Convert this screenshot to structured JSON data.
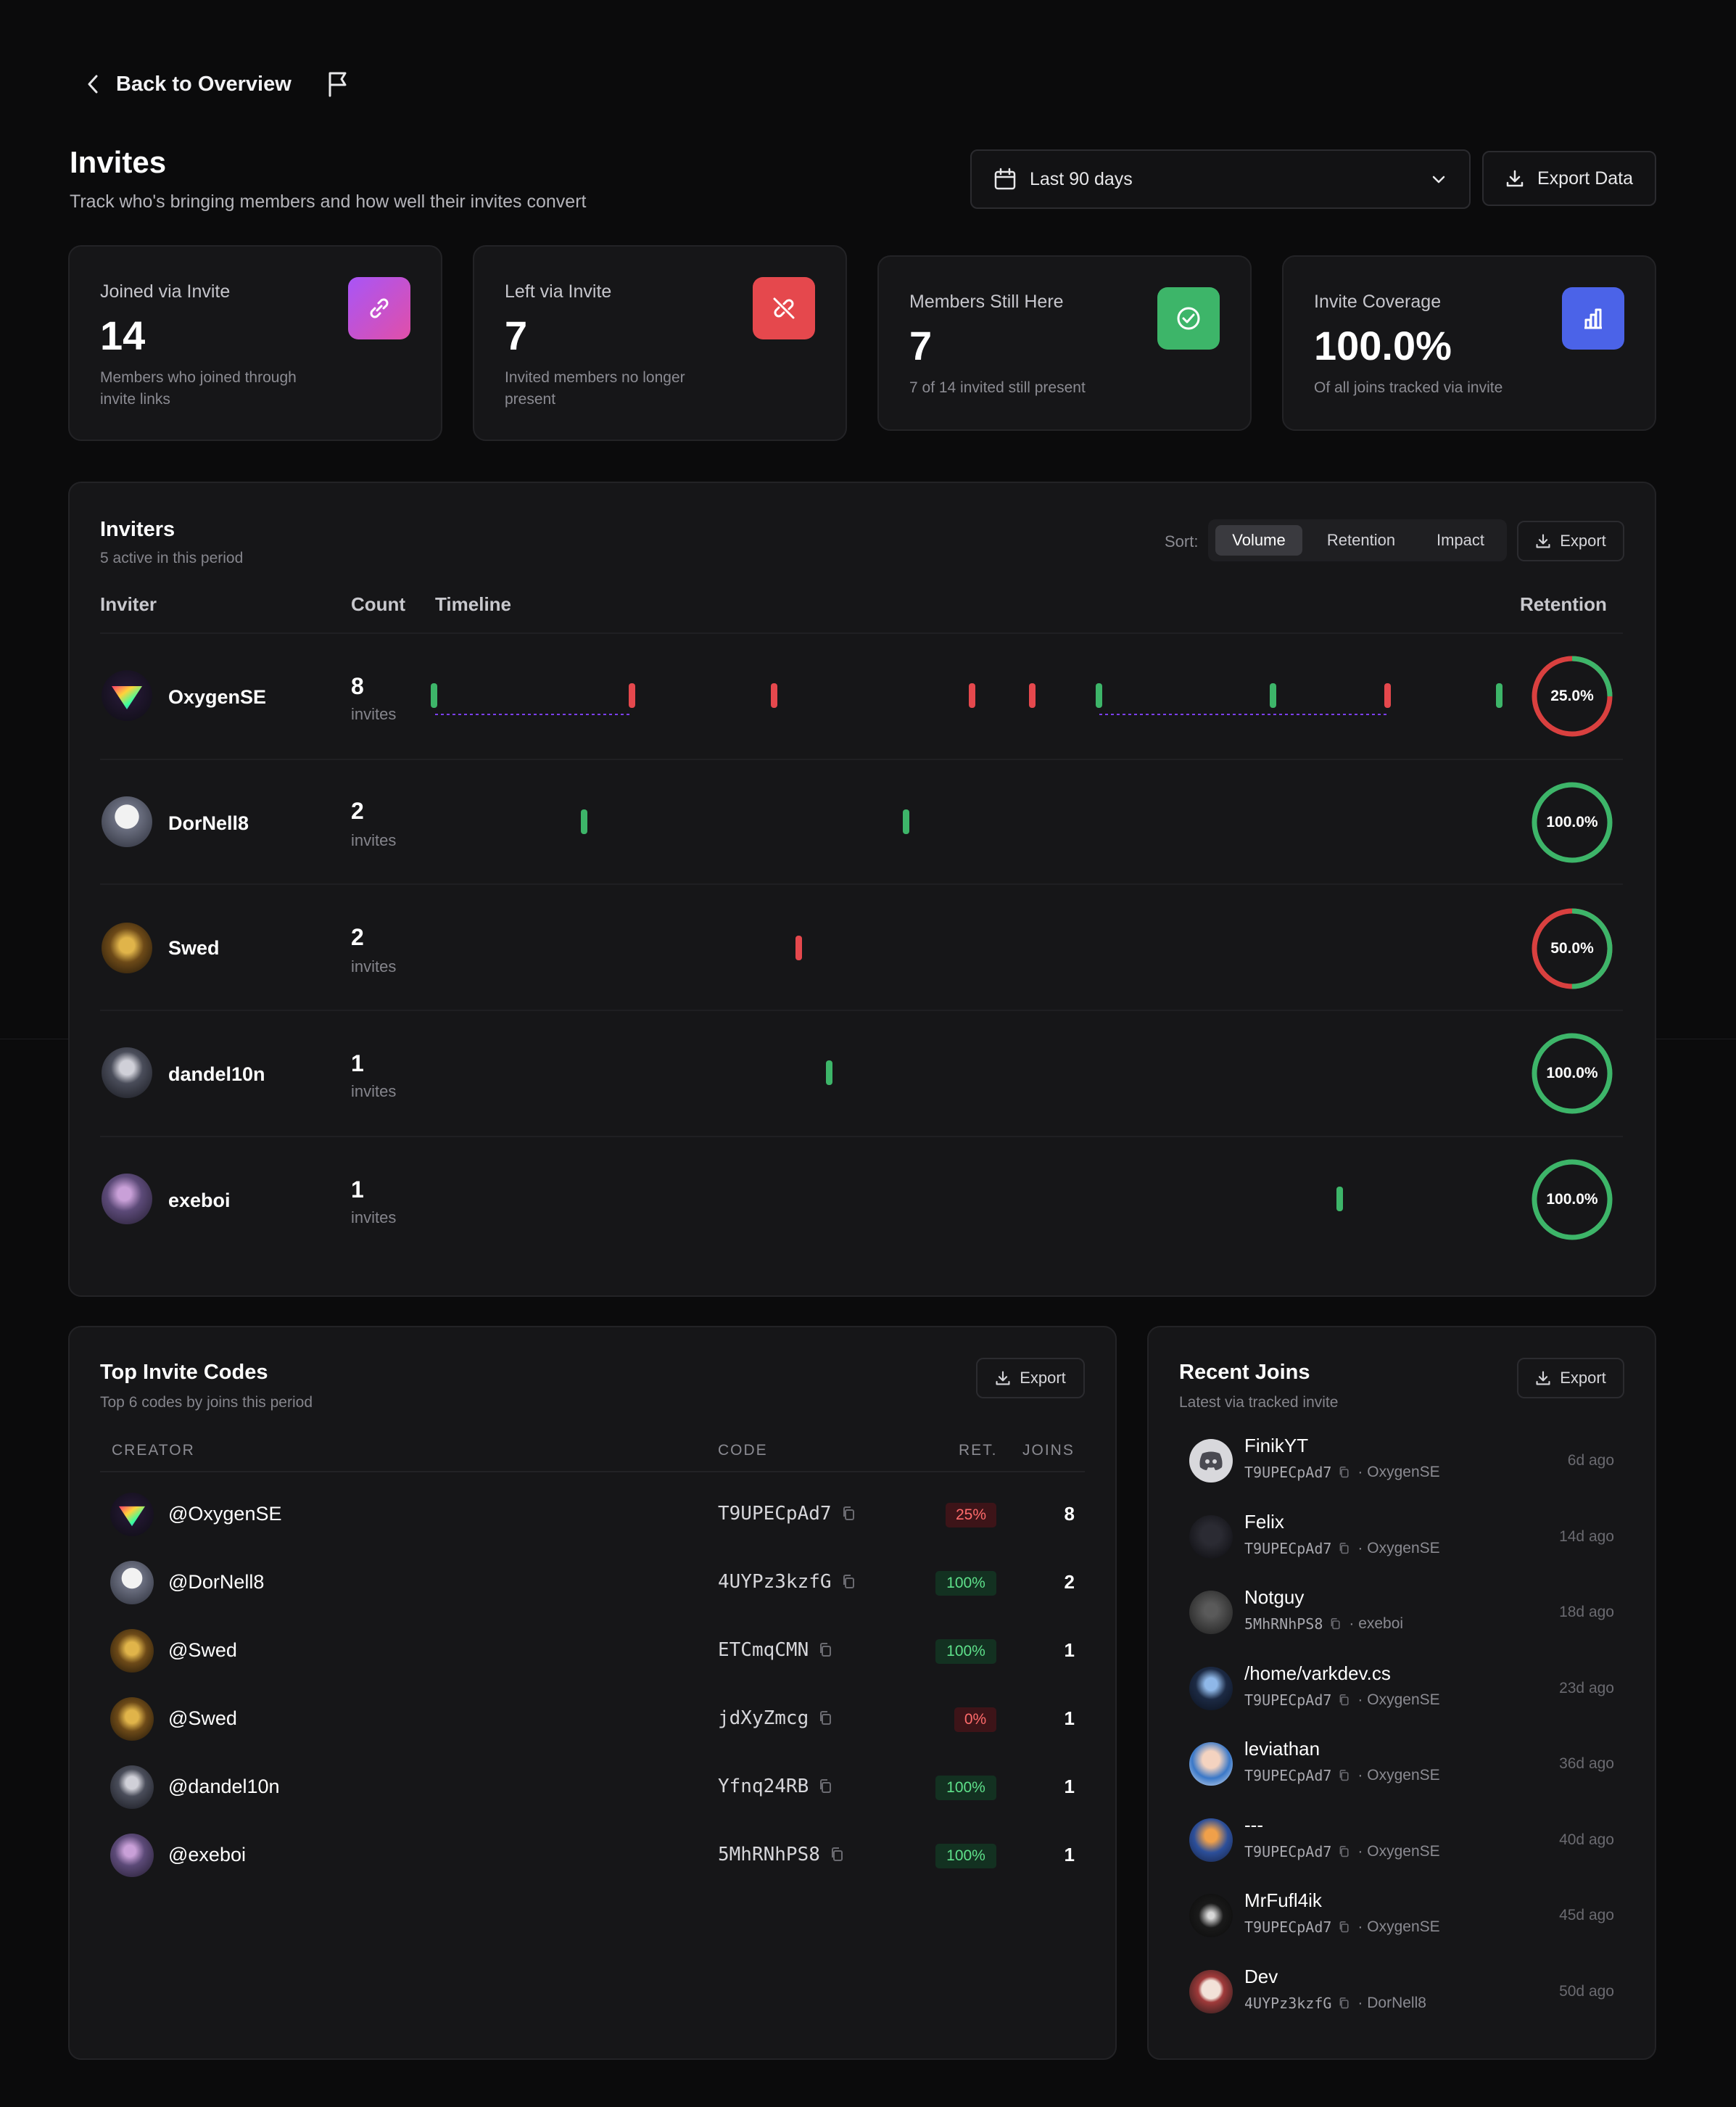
{
  "header": {
    "back_label": "Back to Overview",
    "title": "Invites",
    "subtitle": "Track who's bringing members and how well their invites convert",
    "range_label": "Last 90 days",
    "export_label": "Export Data"
  },
  "stats": [
    {
      "label": "Joined via Invite",
      "value": "14",
      "desc_1": "Members who joined through",
      "desc_2": "invite links",
      "icon": "link-icon",
      "color": "#c04fd6"
    },
    {
      "label": "Left via Invite",
      "value": "7",
      "desc_1": "Invited members no longer",
      "desc_2": "present",
      "icon": "broken-link-icon",
      "color": "#e5484d"
    },
    {
      "label": "Members Still Here",
      "value": "7",
      "desc_1": "7 of 14 invited still present",
      "icon": "check-circle-icon",
      "color": "#3db569"
    },
    {
      "label": "Invite Coverage",
      "value": "100.0%",
      "desc_1": "Of all joins tracked via invite",
      "icon": "bar-chart-icon",
      "color": "#4b63e8"
    }
  ],
  "inviters": {
    "title": "Inviters",
    "subtitle": "5 active in this period",
    "sort_label": "Sort:",
    "sort_options": [
      "Volume",
      "Retention",
      "Impact"
    ],
    "sort_active": "Volume",
    "export_label": "Export",
    "columns": {
      "inviter": "Inviter",
      "count": "Count",
      "timeline": "Timeline",
      "retention": "Retention"
    },
    "unit": "invites",
    "rows": [
      {
        "name": "OxygenSE",
        "count": "8",
        "retention": "25.0%",
        "retention_value": 0.25
      },
      {
        "name": "DorNell8",
        "count": "2",
        "retention": "100.0%",
        "retention_value": 1.0
      },
      {
        "name": "Swed",
        "count": "2",
        "retention": "50.0%",
        "retention_value": 0.5
      },
      {
        "name": "dandel10n",
        "count": "1",
        "retention": "100.0%",
        "retention_value": 1.0
      },
      {
        "name": "exeboi",
        "count": "1",
        "retention": "100.0%",
        "retention_value": 1.0
      }
    ]
  },
  "codes": {
    "title": "Top Invite Codes",
    "subtitle": "Top 6 codes by joins this period",
    "export_label": "Export",
    "columns": {
      "creator": "CREATOR",
      "code": "CODE",
      "ret": "RET.",
      "joins": "JOINS"
    },
    "rows": [
      {
        "creator": "@OxygenSE",
        "code": "T9UPECpAd7",
        "ret": "25%",
        "joins": "8"
      },
      {
        "creator": "@DorNell8",
        "code": "4UYPz3kzfG",
        "ret": "100%",
        "joins": "2"
      },
      {
        "creator": "@Swed",
        "code": "ETCmqCMN",
        "ret": "100%",
        "joins": "1"
      },
      {
        "creator": "@Swed",
        "code": "jdXyZmcg",
        "ret": "0%",
        "joins": "1"
      },
      {
        "creator": "@dandel10n",
        "code": "Yfnq24RB",
        "ret": "100%",
        "joins": "1"
      },
      {
        "creator": "@exeboi",
        "code": "5MhRNhPS8",
        "ret": "100%",
        "joins": "1"
      }
    ]
  },
  "recent": {
    "title": "Recent Joins",
    "subtitle": "Latest via tracked invite",
    "export_label": "Export",
    "rows": [
      {
        "name": "FinikYT",
        "code": "T9UPECpAd7",
        "inviter": "· OxygenSE",
        "time": "6d ago"
      },
      {
        "name": "Felix",
        "code": "T9UPECpAd7",
        "inviter": "· OxygenSE",
        "time": "14d ago"
      },
      {
        "name": "Notguy",
        "code": "5MhRNhPS8",
        "inviter": "· exeboi",
        "time": "18d ago"
      },
      {
        "name": "/home/varkdev.cs",
        "code": "T9UPECpAd7",
        "inviter": "· OxygenSE",
        "time": "23d ago"
      },
      {
        "name": "leviathan",
        "code": "T9UPECpAd7",
        "inviter": "· OxygenSE",
        "time": "36d ago"
      },
      {
        "name": "---",
        "code": "T9UPECpAd7",
        "inviter": "· OxygenSE",
        "time": "40d ago"
      },
      {
        "name": "MrFufl4ik",
        "code": "T9UPECpAd7",
        "inviter": "· OxygenSE",
        "time": "45d ago"
      },
      {
        "name": "Dev",
        "code": "4UYPz3kzfG",
        "inviter": "· DorNell8",
        "time": "50d ago"
      }
    ]
  }
}
